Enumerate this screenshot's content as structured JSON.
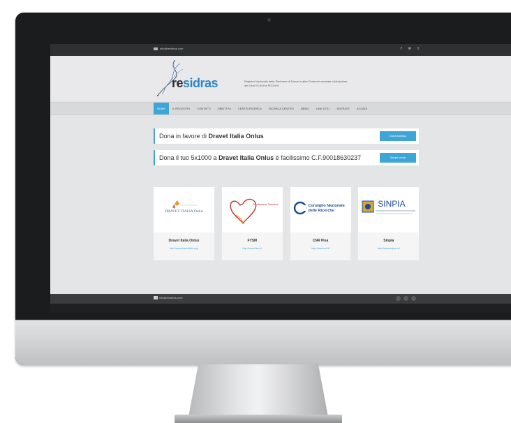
{
  "topbar": {
    "email": "info@residras.com",
    "social_icons": "f ✉ t"
  },
  "header": {
    "logo_part1": "re",
    "logo_part2": "sidras",
    "tagline": "Registro Nazionale della Sindrome di Dravet e altre Sindromi correlate a Mutazione dei Geni SCN1A e PCDH19"
  },
  "nav": {
    "items": [
      "HOME",
      "IL REGISTRO",
      "CONTATTI",
      "OBIETTIVI",
      "CENTRI RICERCA",
      "RICERCA CENTRO",
      "NEWS",
      "LINK UTILI",
      "ENTRATE",
      "ACCEDI"
    ],
    "active_index": 0
  },
  "donations": [
    {
      "prefix": "Dona in favore di ",
      "org": "Dravet Italia Onlus",
      "suffix": "",
      "button": "Dona Adesso"
    },
    {
      "prefix": "Dona il tuo 5x1000 a ",
      "org": "Dravet Italia Onlus",
      "suffix": " è facilissimo C.F.90018630237",
      "button": "Scopri come"
    }
  ],
  "partners": [
    {
      "name": "Dravet Italia Onlus",
      "url": "http://www.dravetitalia.org/",
      "logo_text": "DRAVET ITALIA Onlus"
    },
    {
      "name": "FTSM",
      "url": "http://www.ftsm.it/",
      "logo_text": "Fondazione Toscana"
    },
    {
      "name": "CNR Pisa",
      "url": "http://www.cnr.it/",
      "logo_text": "Consiglio Nazionale delle Ricerche"
    },
    {
      "name": "Sinpia",
      "url": "http://www.sinpia.eu/",
      "logo_text": "SINPIA"
    }
  ],
  "footer": {
    "email": "info@residras.com"
  },
  "colors": {
    "accent": "#3ea6d6",
    "topbar": "#2f3032",
    "logo_blue": "#2f86c5"
  }
}
